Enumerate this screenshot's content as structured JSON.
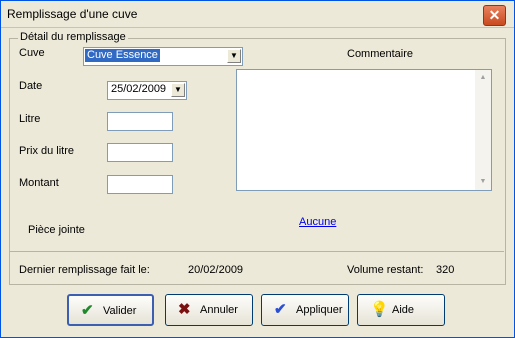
{
  "window": {
    "title": "Remplissage d'une cuve",
    "close_symbol": "✕"
  },
  "group": {
    "legend": "Détail du remplissage"
  },
  "fields": {
    "cuve": {
      "label": "Cuve",
      "value": "Cuve Essence"
    },
    "date": {
      "label": "Date",
      "value": "25/02/2009"
    },
    "litre": {
      "label": "Litre",
      "value": ""
    },
    "prix": {
      "label": "Prix du litre",
      "value": ""
    },
    "montant": {
      "label": "Montant",
      "value": ""
    },
    "commentaire": {
      "label": "Commentaire",
      "value": ""
    }
  },
  "piece_jointe": {
    "label": "Pièce jointe",
    "link": "Aucune"
  },
  "status": {
    "dernier_label": "Dernier remplissage fait le:",
    "dernier_value": "20/02/2009",
    "volume_label": "Volume restant:",
    "volume_value": "320"
  },
  "buttons": {
    "valider": {
      "label": "Valider",
      "icon": "check-icon",
      "color": "#1f8a2b"
    },
    "annuler": {
      "label": "Annuler",
      "icon": "cross-icon",
      "color": "#7a1010"
    },
    "appliquer": {
      "label": "Appliquer",
      "icon": "check-icon",
      "color": "#2a4fd6"
    },
    "aide": {
      "label": "Aide",
      "icon": "lightbulb-icon",
      "color": "#b07a10"
    }
  },
  "colors": {
    "window_bg": "#ece9d8",
    "title_border": "#0054e3",
    "selection": "#316ac5",
    "link": "#0000ee"
  }
}
